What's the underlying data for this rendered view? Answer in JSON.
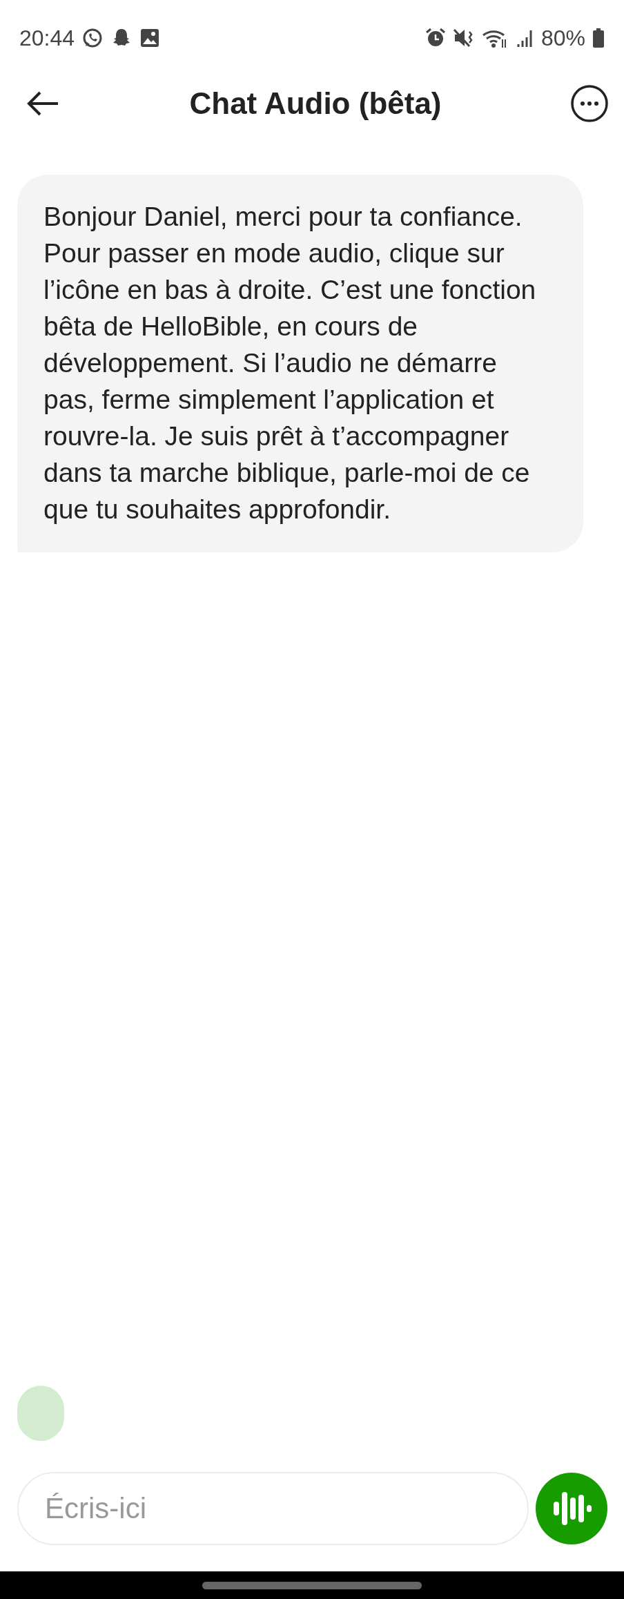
{
  "status_bar": {
    "time": "20:44",
    "battery": "80%"
  },
  "header": {
    "title": "Chat Audio (bêta)"
  },
  "messages": [
    {
      "text": "Bonjour Daniel, merci pour ta confiance. Pour passer en mode audio, clique sur l’icône en bas à droite. C’est une fonction bêta de HelloBible, en cours de développement. Si l’audio ne démarre pas, ferme simplement l’application et rouvre-la. Je suis prêt à t’accompagner dans ta marche biblique, parle-moi de ce que tu souhaites approfondir."
    }
  ],
  "composer": {
    "placeholder": "Écris-ici"
  }
}
